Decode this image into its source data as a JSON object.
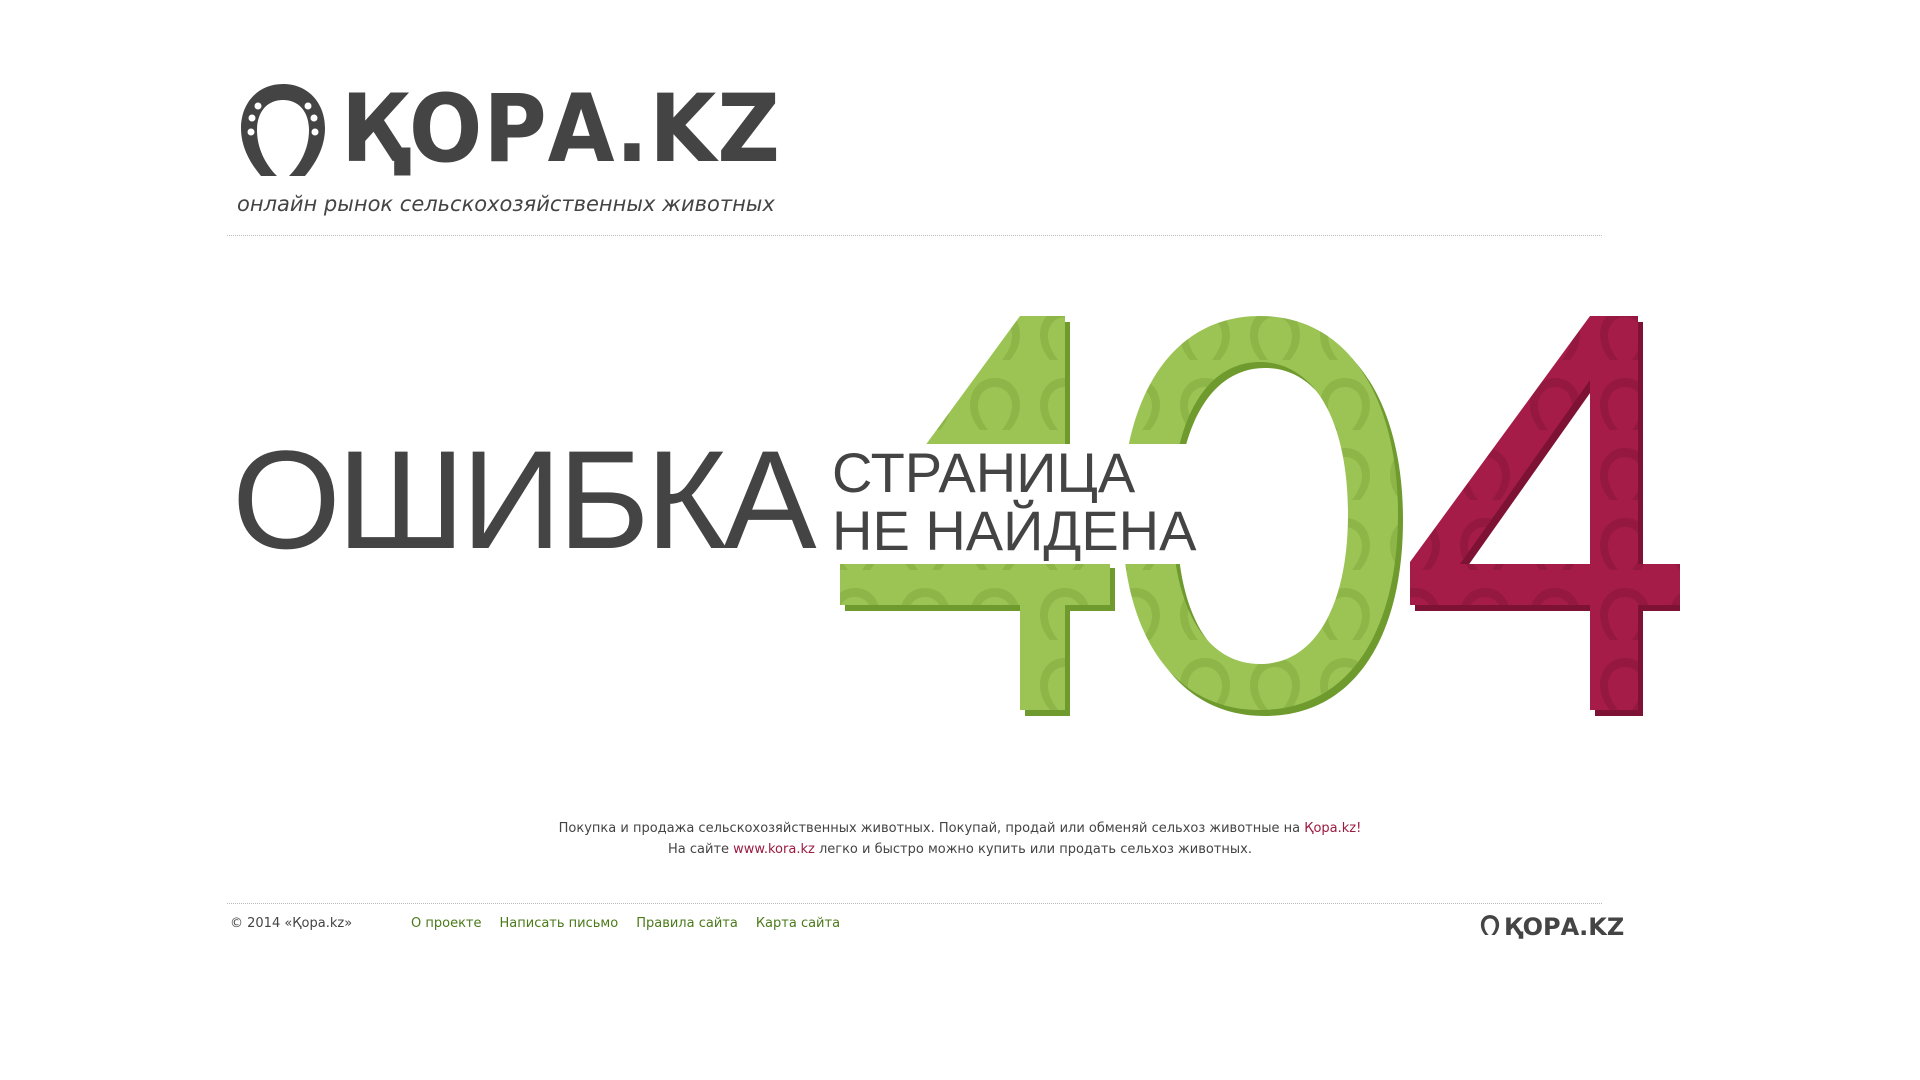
{
  "header": {
    "logo_text": "ҚОРА.KZ",
    "tagline": "онлайн рынок сельскохозяйственных животных"
  },
  "error": {
    "title": "ОШИБКА",
    "code": "404",
    "message_line1": "СТРАНИЦА",
    "message_line2": "НЕ НАЙДЕНА"
  },
  "description": {
    "line1_text": "Покупка и продажа сельскохозяйственных животных. Покупай, продай или обменяй сельхоз животные на ",
    "line1_link": "Қора.kz!",
    "line2_prefix": "На сайте ",
    "line2_link": "www.kora.kz",
    "line2_suffix": " легко и быстро можно купить или продать сельхоз животных."
  },
  "footer": {
    "copyright": "© 2014 «Қора.kz»",
    "links": [
      "О проекте",
      "Написать письмо",
      "Правила сайта",
      "Карта сайта"
    ],
    "logo_text": "ҚОРА.KZ"
  },
  "colors": {
    "text": "#444444",
    "green": "#9cc455",
    "green_dark": "#6e9a2e",
    "crimson": "#a51c48",
    "crimson_dark": "#7e1234",
    "link_red": "#9b1a41",
    "link_green": "#4a7a1a"
  },
  "icons": [
    "horseshoe-logo-icon"
  ]
}
